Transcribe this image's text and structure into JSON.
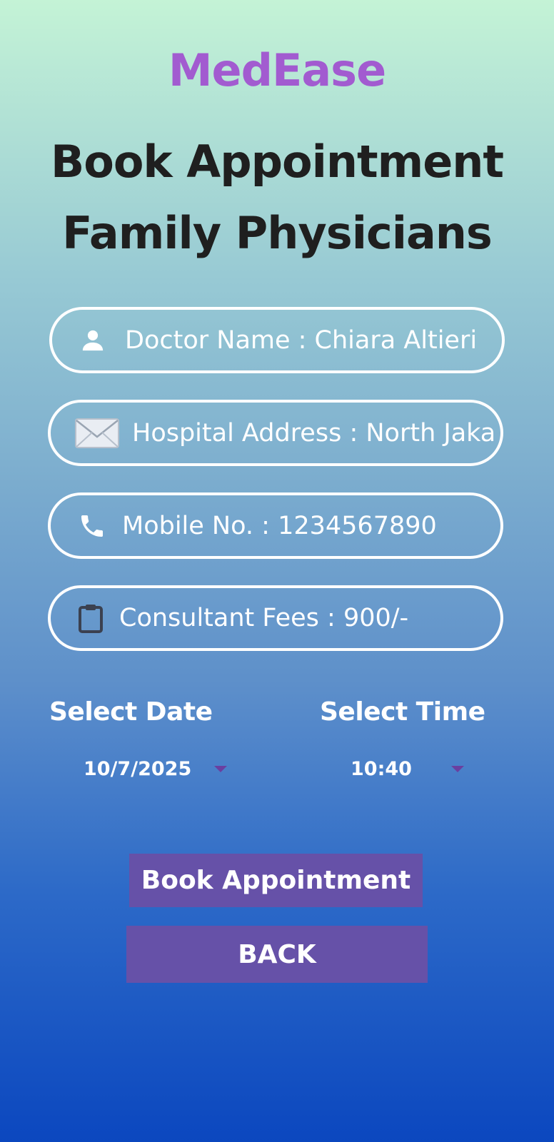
{
  "app": {
    "title": "MedEase"
  },
  "header": {
    "line1": "Book Appointment",
    "line2": "Family Physicians"
  },
  "fields": [
    {
      "icon": "person-icon",
      "text": "Doctor Name : Chiara Altieri"
    },
    {
      "icon": "envelope-icon",
      "text": "Hospital Address : North Jaka"
    },
    {
      "icon": "phone-icon",
      "text": "Mobile No. : 1234567890"
    },
    {
      "icon": "clipboard-icon",
      "text": "Consultant Fees : 900/-"
    }
  ],
  "date": {
    "label": "Select Date",
    "value": "10/7/2025"
  },
  "time": {
    "label": "Select Time",
    "value": "10:40"
  },
  "buttons": {
    "book": "Book Appointment",
    "back": "BACK"
  },
  "colors": {
    "brand": "#a25bd0",
    "button": "#6651a8",
    "dropdown_arrow": "#6a3fa0"
  }
}
